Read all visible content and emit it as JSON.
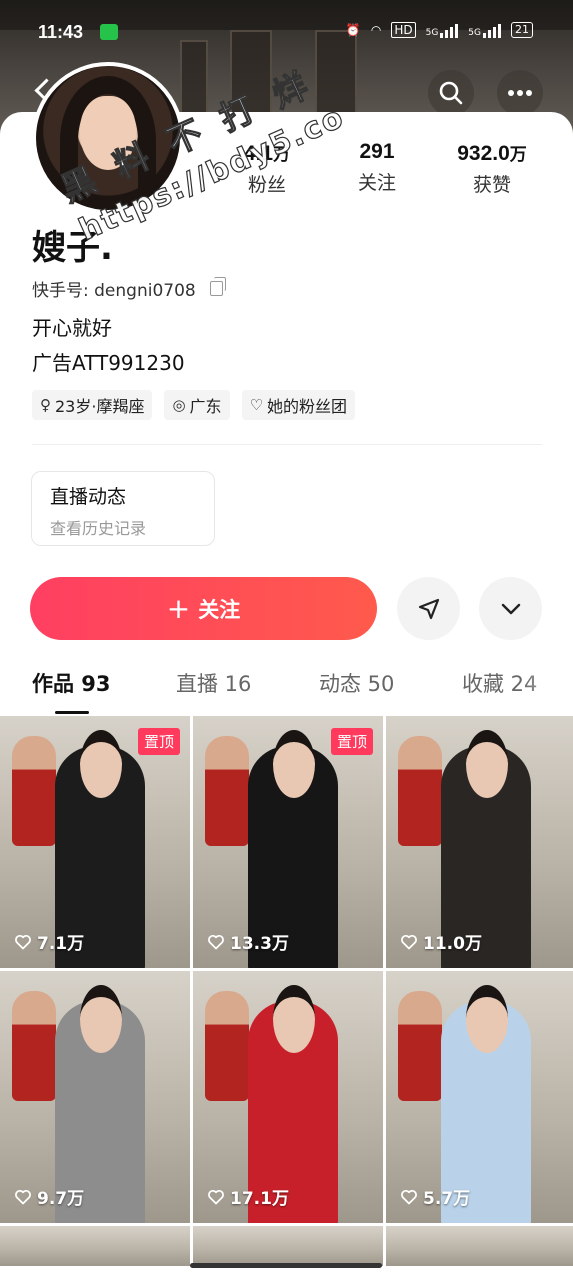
{
  "status_bar": {
    "time": "11:43",
    "network1": "5G",
    "network2": "5G",
    "hd": "HD",
    "battery": "21"
  },
  "profile": {
    "name": "嫂子.",
    "kuaishou_id": "快手号: dengni0708",
    "bio_line1": "开心就好",
    "bio_line2": "广告ATT991230",
    "tags": [
      {
        "icon": "gender-female-icon",
        "glyph": "♀",
        "label": "23岁·摩羯座"
      },
      {
        "icon": "location-icon",
        "glyph": "◎",
        "label": "广东"
      },
      {
        "icon": "fan-group-icon",
        "glyph": "♡",
        "label": "她的粉丝团"
      }
    ]
  },
  "stats": {
    "fans": {
      "value": "4.1",
      "unit": "万",
      "label": "粉丝"
    },
    "following": {
      "value": "291",
      "label": "关注"
    },
    "likes": {
      "value": "932.0",
      "unit": "万",
      "label": "获赞"
    }
  },
  "watermark": {
    "line1": "黑 料 不 打 烊",
    "line2": "https://bdy5.co"
  },
  "live_box": {
    "title": "直播动态",
    "subtitle": "查看历史记录"
  },
  "actions": {
    "follow_label": "关注",
    "follow_plus": "+"
  },
  "tabs": [
    {
      "label": "作品 93",
      "active": true
    },
    {
      "label": "直播 16",
      "active": false
    },
    {
      "label": "动态 50",
      "active": false
    },
    {
      "label": "收藏 24",
      "active": false
    }
  ],
  "videos": [
    {
      "likes": "7.1万",
      "pinned": "置顶",
      "outfit": "#1c1c1c"
    },
    {
      "likes": "13.3万",
      "pinned": "置顶",
      "outfit": "#161616"
    },
    {
      "likes": "11.0万",
      "pinned": "",
      "outfit": "#2a2624"
    },
    {
      "likes": "9.7万",
      "pinned": "",
      "outfit": "#8d8d8d"
    },
    {
      "likes": "17.1万",
      "pinned": "",
      "outfit": "#c8202a"
    },
    {
      "likes": "5.7万",
      "pinned": "",
      "outfit": "#b9d2ea"
    }
  ],
  "colors": {
    "accent": "#ff3f62",
    "pinned_badge": "#ff3a5c"
  }
}
